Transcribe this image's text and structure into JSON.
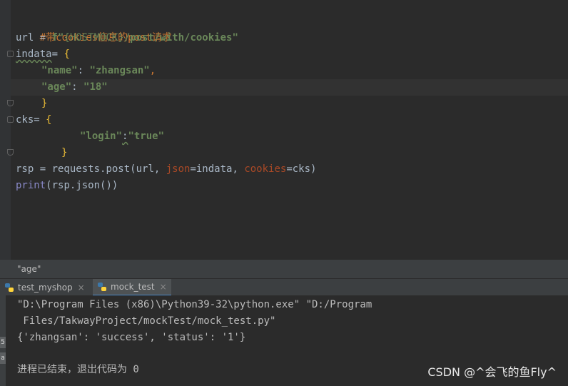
{
  "editor": {
    "lines": [
      {
        "comment": "#带cookies信息的post请求"
      },
      {
        "p1": "url = ",
        "p2": "f\"",
        "p3": "{HOSTMOCK}",
        "p4": "/post/with/cookies\""
      },
      {
        "p1": "indata",
        "p2": "= ",
        "p3": "{"
      },
      {
        "p1": "\"name\"",
        "p2": ": ",
        "p3": "\"zhangsan\"",
        "p4": ","
      },
      {
        "p1": "\"age\"",
        "p2": ": ",
        "p3": "\"18\""
      },
      {
        "p1": "}"
      },
      {
        "p1": "cks",
        "p2": "= ",
        "p3": "{"
      },
      {
        "p1": "\"login\"",
        "p2": ":",
        "p3": "\"true\""
      },
      {
        "p1": "}"
      },
      {
        "p1": "rsp = requests.",
        "p2": "post",
        "p3": "(url, ",
        "p4": "json",
        "p5": "=indata, ",
        "p6": "cookies",
        "p7": "=cks)"
      },
      {
        "p1": "print",
        "p2": "(rsp.",
        "p3": "json",
        "p4": "())"
      }
    ]
  },
  "breadcrumb": {
    "text": "\"age\""
  },
  "tabs": [
    {
      "label": "test_myshop",
      "close": "×"
    },
    {
      "label": "mock_test",
      "close": "×"
    }
  ],
  "console": {
    "lines": [
      "\"D:\\Program Files (x86)\\Python39-32\\python.exe\" \"D:/Program",
      " Files/TakwayProject/mockTest/mock_test.py\"",
      "{'zhangsan': 'success', 'status': '1'}",
      "进程已结束，退出代码为 0"
    ]
  },
  "sidebar_labels": [
    "5",
    "a"
  ],
  "watermark": "CSDN @^会飞的鱼Fly^",
  "colors": {
    "background": "#2b2b2b",
    "keyword": "#cc7832",
    "string": "#6a8759",
    "brace": "#e8ba36",
    "builtin": "#8888c6",
    "param": "#aa4926"
  }
}
